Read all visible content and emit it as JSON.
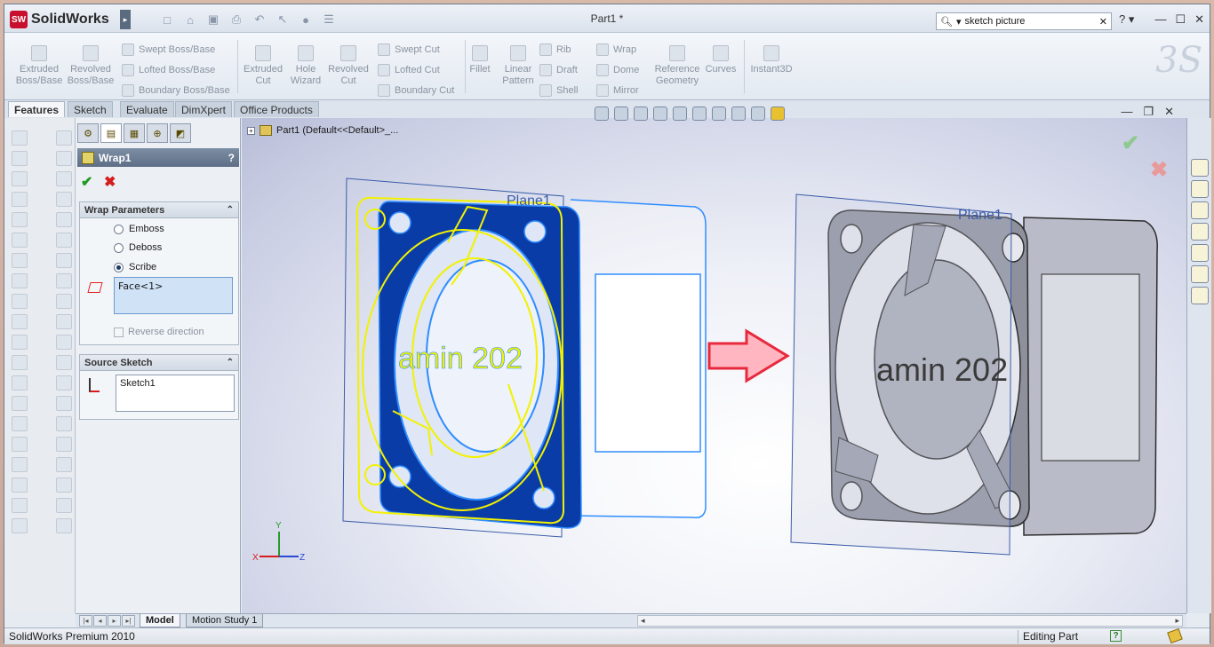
{
  "app": {
    "brand": "SolidWorks",
    "document_title": "Part1 *",
    "search_value": "sketch picture",
    "help": "?"
  },
  "command_manager": {
    "extruded_boss": "Extruded\nBoss/Base",
    "revolved_boss": "Revolved\nBoss/Base",
    "swept_boss": "Swept Boss/Base",
    "lofted_boss": "Lofted Boss/Base",
    "boundary_boss": "Boundary Boss/Base",
    "extruded_cut": "Extruded\nCut",
    "hole_wizard": "Hole\nWizard",
    "revolved_cut": "Revolved\nCut",
    "swept_cut": "Swept Cut",
    "lofted_cut": "Lofted Cut",
    "boundary_cut": "Boundary Cut",
    "fillet": "Fillet",
    "linear_pattern": "Linear\nPattern",
    "rib": "Rib",
    "draft": "Draft",
    "shell": "Shell",
    "wrap": "Wrap",
    "dome": "Dome",
    "mirror": "Mirror",
    "reference_geometry": "Reference\nGeometry",
    "curves": "Curves",
    "instant3d": "Instant3D"
  },
  "tabs": [
    "Features",
    "Sketch",
    "Evaluate",
    "DimXpert",
    "Office Products"
  ],
  "property_manager": {
    "title": "Wrap1",
    "help": "?",
    "wrap_parameters": {
      "header": "Wrap Parameters",
      "options": [
        "Emboss",
        "Deboss",
        "Scribe"
      ],
      "selected": "Scribe",
      "face": "Face<1>",
      "reverse_direction": "Reverse direction"
    },
    "source_sketch": {
      "header": "Source Sketch",
      "sketch": "Sketch1"
    }
  },
  "viewport": {
    "tree_item": "Part1  (Default<<Default>_...",
    "plane_label": "Plane1",
    "engraved_text": "amin 202",
    "axis_x": "X",
    "axis_y": "Y",
    "axis_z": "Z"
  },
  "bottom_tabs": [
    "Model",
    "Motion Study 1"
  ],
  "status": {
    "product": "SolidWorks Premium 2010",
    "mode": "Editing Part"
  },
  "colors": {
    "sketch_yellow": "#f2f200",
    "wireframe_blue": "#2f8dff",
    "selected_face_blue": "#0a3ca8",
    "arrow_red": "#e8283c",
    "accept_green": "#1e9a1e",
    "cancel_red": "#d41c1c"
  }
}
